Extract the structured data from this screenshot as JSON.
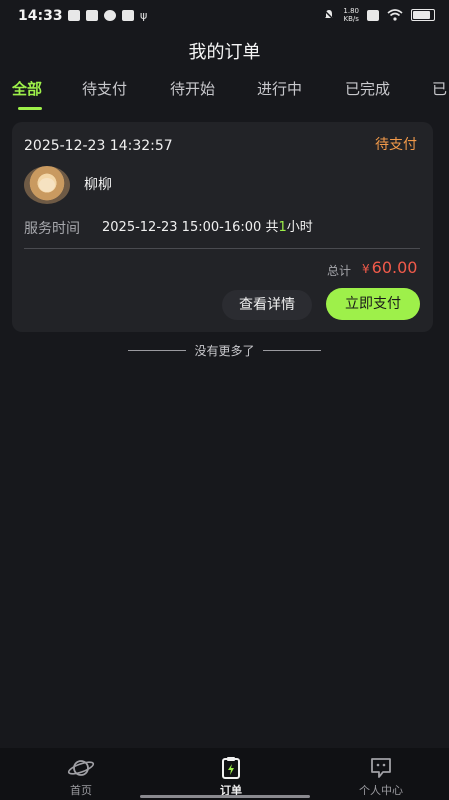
{
  "status_bar": {
    "time": "14:33",
    "net_speed_value": "1.80",
    "net_speed_unit": "KB/s",
    "left_icons": [
      "message-icon",
      "mail-icon",
      "app-icon",
      "telegram-icon",
      "usb-icon"
    ],
    "right_icons": [
      "mute-icon",
      "net-speed",
      "sim-icon",
      "wifi-icon",
      "battery-icon"
    ]
  },
  "header": {
    "title": "我的订单"
  },
  "tabs": [
    {
      "label": "全部",
      "active": true
    },
    {
      "label": "待支付",
      "active": false
    },
    {
      "label": "待开始",
      "active": false
    },
    {
      "label": "进行中",
      "active": false
    },
    {
      "label": "已完成",
      "active": false
    },
    {
      "label": "已",
      "active": false
    }
  ],
  "order": {
    "datetime": "2025-12-23 14:32:57",
    "status": "待支付",
    "staff_name": "柳柳",
    "service_time_label": "服务时间",
    "service_time_range": "2025-12-23 15:00-16:00",
    "duration_prefix": "共",
    "duration_value": "1",
    "duration_unit": "小时",
    "total_label": "总计",
    "currency": "¥",
    "total_amount": "60.00",
    "detail_button": "查看详情",
    "pay_button": "立即支付"
  },
  "list_end": {
    "text": "没有更多了"
  },
  "bottom_nav": [
    {
      "label": "首页",
      "icon": "planet-icon",
      "active": false
    },
    {
      "label": "订单",
      "icon": "clipboard-icon",
      "active": true
    },
    {
      "label": "个人中心",
      "icon": "chat-face-icon",
      "active": false
    }
  ],
  "colors": {
    "accent": "#9ef04a",
    "status_pending": "#f29a4a",
    "price": "#f05a4a",
    "background": "#17181c",
    "card": "#222327"
  }
}
